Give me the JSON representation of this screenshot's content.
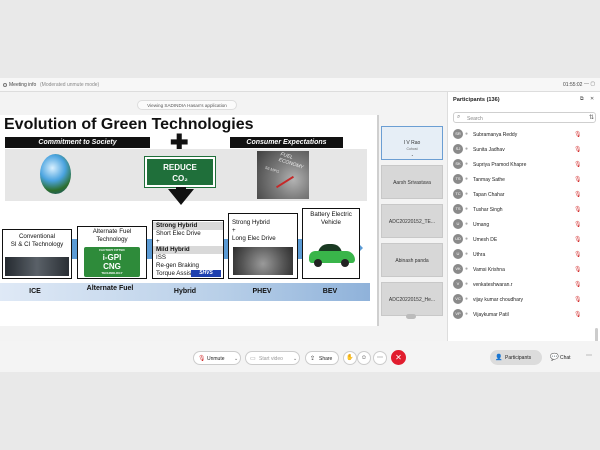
{
  "topbar": {
    "title": "Meeting info",
    "mode": "(Moderated unmute mode)",
    "time": "01:55:02"
  },
  "share_banner": "Viewing SADINDIA Hasan's application",
  "slide": {
    "title": "Evolution of Green Technologies",
    "header_left": "Commitment to Society",
    "header_right": "Consumer Expectations",
    "plus": "✚",
    "reduce_line1": "REDUCE",
    "reduce_line2": "CO₂",
    "gauge_fuel": "FUEL",
    "gauge_economy": "ECONOMY",
    "gauge_small": "56 MPG",
    "box1": {
      "line1": "Conventional",
      "line2": "SI & CI Technology"
    },
    "box2": {
      "line1": "Alternate Fuel",
      "line2": "Technology",
      "cng_top": "FACTORY FITTED",
      "cng_line1": "i-GPI",
      "cng_line2": "CNG",
      "cng_bottom": "TECHNOLOGY"
    },
    "box3": {
      "h1": "Strong Hybrid",
      "l1": "Short Elec Drive",
      "plus": "+",
      "h2": "Mild Hybrid",
      "l2": "ISS",
      "l3": "Re-gen Braking",
      "l4": "Torque Assist",
      "badge": "SHVS"
    },
    "box4": {
      "l1": "Strong Hybrid",
      "plus": "+",
      "l2": "Long Elec Drive"
    },
    "box5": {
      "l1": "Battery Electric",
      "l2": "Vehicle"
    },
    "stages": [
      "ICE",
      "Alternate Fuel",
      "Hybrid",
      "PHEV",
      "BEV"
    ]
  },
  "tiles": [
    {
      "name": "I V Rao",
      "sub": "Cohost",
      "active": true
    },
    {
      "name": "Aarsh Srivastava",
      "sub": "",
      "active": false
    },
    {
      "name": "ADC20220152_TE...",
      "sub": "",
      "active": false
    },
    {
      "name": "Abinash panda",
      "sub": "",
      "active": false
    },
    {
      "name": "ADC20220152_He...",
      "sub": "",
      "active": false
    }
  ],
  "participants": {
    "title": "Participants (136)",
    "search_placeholder": "Search",
    "list": [
      {
        "initials": "SR",
        "name": "Subramanya Reddy"
      },
      {
        "initials": "SJ",
        "name": "Sunita Jadhav"
      },
      {
        "initials": "SK",
        "name": "Supriya Pramod Khapre"
      },
      {
        "initials": "TS",
        "name": "Tanmay Sathe"
      },
      {
        "initials": "TC",
        "name": "Tapan Chahar"
      },
      {
        "initials": "TS",
        "name": "Tushar Singh"
      },
      {
        "initials": "U",
        "name": "Umang"
      },
      {
        "initials": "UD",
        "name": "Umesh DE"
      },
      {
        "initials": "U",
        "name": "Uthra"
      },
      {
        "initials": "VK",
        "name": "Vamsi Krishna"
      },
      {
        "initials": "V",
        "name": "venkateshwaran.r"
      },
      {
        "initials": "VC",
        "name": "vijay kumar choudhary"
      },
      {
        "initials": "VP",
        "name": "Vijaykumar Patil"
      }
    ]
  },
  "bottombar": {
    "unmute": "Unmute",
    "start_video": "Start video",
    "share": "Share",
    "participants": "Participants",
    "chat": "Chat"
  },
  "colors": {
    "end_call": "#e11d2e",
    "mute_red": "#d32f2f",
    "flow_blue": "#5b9bd5",
    "reduce_green": "#1f6f3a"
  }
}
